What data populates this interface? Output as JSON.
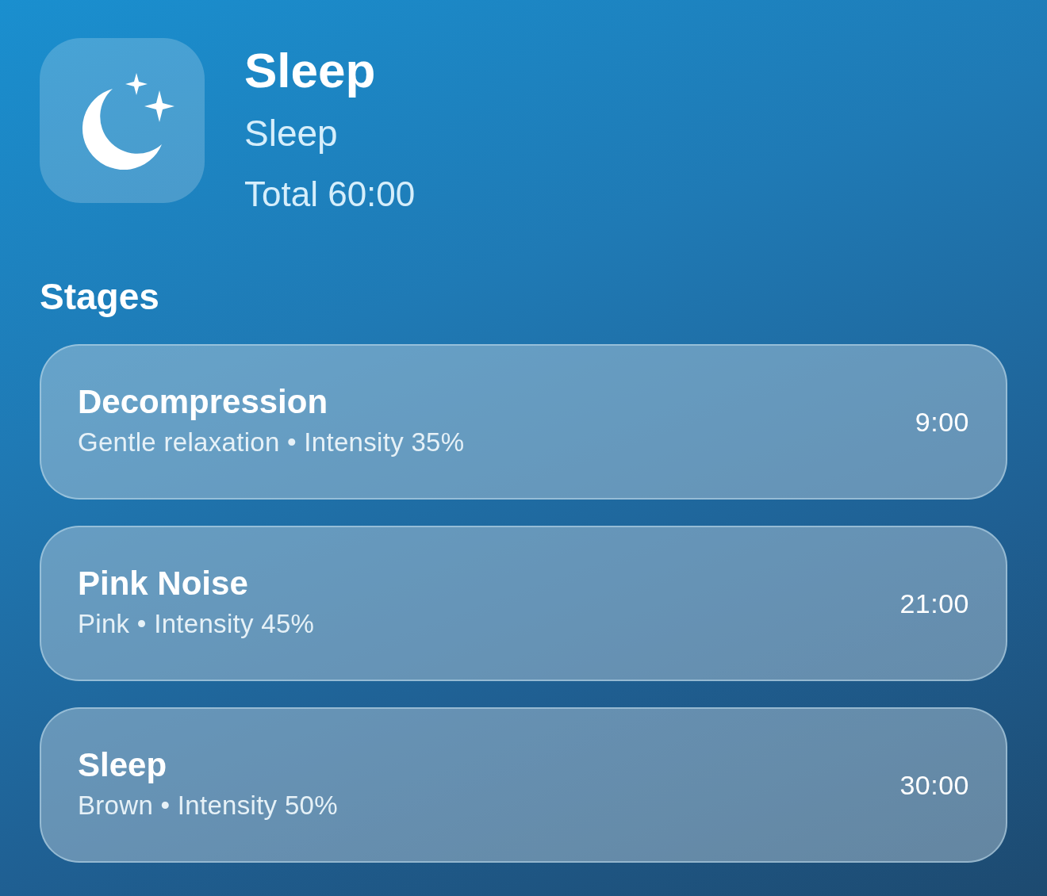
{
  "header": {
    "title": "Sleep",
    "subtitle": "Sleep",
    "total": "Total 60:00"
  },
  "section_title": "Stages",
  "stages": [
    {
      "name": "Decompression",
      "detail": "Gentle relaxation • Intensity 35%",
      "duration": "9:00"
    },
    {
      "name": "Pink Noise",
      "detail": "Pink • Intensity 45%",
      "duration": "21:00"
    },
    {
      "name": "Sleep",
      "detail": "Brown • Intensity 50%",
      "duration": "30:00"
    }
  ]
}
